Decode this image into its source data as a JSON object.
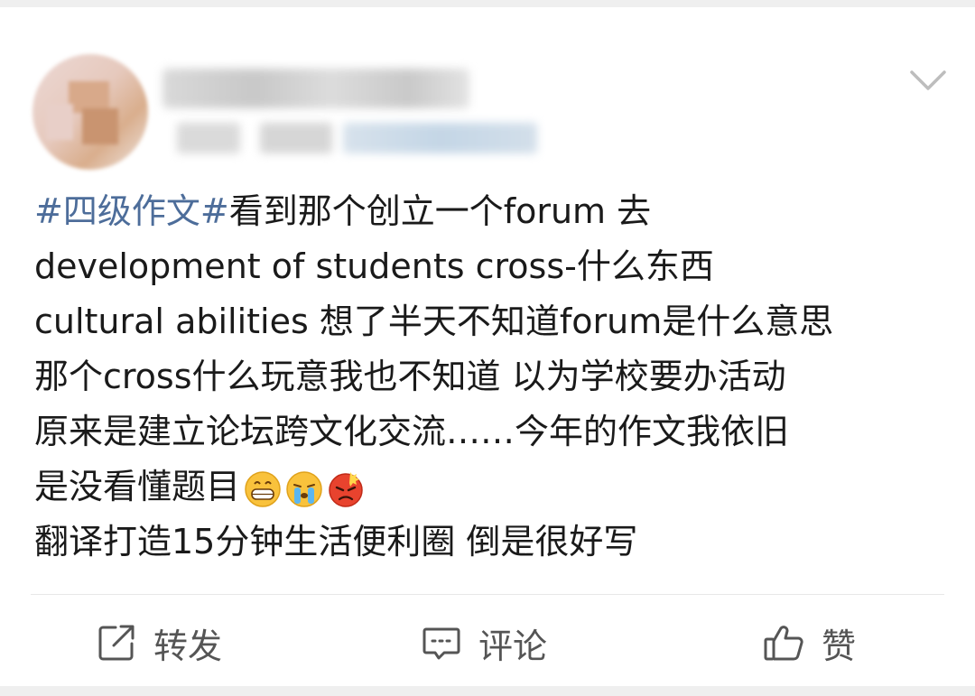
{
  "post": {
    "hashtag": "#四级作文#",
    "lines": [
      "看到那个创立一个forum 去",
      "development of students  cross-什么东西",
      "cultural abilities  想了半天不知道forum是什么意思",
      "那个cross什么玩意我也不知道  以为学校要办活动",
      "原来是建立论坛跨文化交流……今年的作文我依旧",
      "是没看懂题目",
      "翻译打造15分钟生活便利圈 倒是很好写"
    ],
    "emojis": [
      "grinning-face-icon",
      "crying-face-icon",
      "angry-face-icon"
    ]
  },
  "actions": {
    "repost_label": "转发",
    "comment_label": "评论",
    "like_label": "赞"
  },
  "colors": {
    "hashtag": "#4d6d9a",
    "text": "#1a1a1a",
    "action_text": "#555555",
    "background": "#ffffff"
  }
}
